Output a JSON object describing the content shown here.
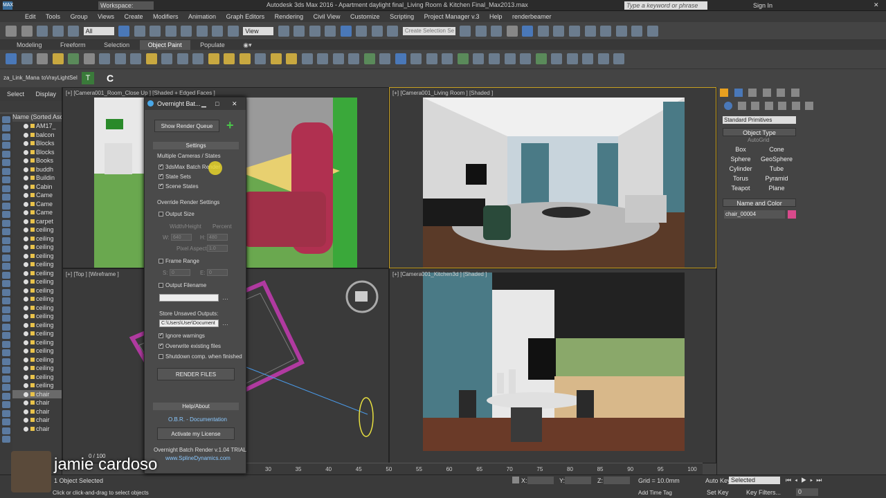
{
  "titlebar": {
    "workspace": "Workspace: Default",
    "title": "Autodesk 3ds Max 2016 - Apartment daylight final_Living Room & Kitchen Final_Max2013.max",
    "search_placeholder": "Type a keyword or phrase",
    "signin": "Sign In"
  },
  "menu": [
    "Edit",
    "Tools",
    "Group",
    "Views",
    "Create",
    "Modifiers",
    "Animation",
    "Graph Editors",
    "Rendering",
    "Civil View",
    "Customize",
    "Scripting",
    "Project Manager v.3",
    "Help",
    "renderbeamer"
  ],
  "toolbar": {
    "filter_value": "All",
    "view_value": "View",
    "selection_set_placeholder": "Create Selection Se"
  },
  "ribbon_tabs": [
    {
      "label": "Modeling",
      "active": false
    },
    {
      "label": "Freeform",
      "active": false
    },
    {
      "label": "Selection",
      "active": false
    },
    {
      "label": "Object Paint",
      "active": true
    },
    {
      "label": "Populate",
      "active": false
    }
  ],
  "tb3": {
    "btn1": "za_Link_Mana",
    "btn2": "toVrayLightSel"
  },
  "scene_explorer": {
    "tabs": [
      "Select",
      "Display"
    ],
    "column": "Name (Sorted Ascen",
    "items": [
      "AM17_",
      "balcon",
      "Blocks",
      "Blocks",
      "Books",
      "buddh",
      "Buildin",
      "Cabin",
      "Came",
      "Came",
      "Came",
      "carpet",
      "ceiling",
      "ceiling",
      "ceiling",
      "ceiling",
      "ceiling",
      "ceiling",
      "ceiling",
      "ceiling",
      "ceiling",
      "ceiling",
      "ceiling",
      "ceiling",
      "ceiling",
      "ceiling",
      "ceiling",
      "ceiling",
      "ceiling",
      "ceiling",
      "ceiling",
      "chair",
      "chair",
      "chair",
      "chair",
      "chair"
    ],
    "selected_index": 31
  },
  "viewports": [
    {
      "label": "[+] [Camera001_Room_Close Up ] [Shaded + Edged Faces ]"
    },
    {
      "label": "[+] [Camera001_Living Room ] [Shaded ]"
    },
    {
      "label": "[+] [Top ] [Wireframe ]"
    },
    {
      "label": "[+] [Camera001_Kitchen3d ] [Shaded ]"
    }
  ],
  "dialog": {
    "title": "Overnight Bat...",
    "show_queue": "Show Render Queue",
    "settings": "Settings",
    "multiple_cams": "Multiple Cameras / States",
    "opt_batch": "3dsMax Batch Render",
    "opt_state_sets": "State Sets",
    "opt_scene_states": "Scene States",
    "override": "Override Render Settings",
    "output_size": "Output Size",
    "width_height": "Width/Height",
    "percent": "Percent",
    "w_label": "W:",
    "w_value": "640",
    "h_label": "H:",
    "h_value": "480",
    "pixel_aspect": "Pixel Aspect",
    "pixel_aspect_value": "1.0",
    "frame_range": "Frame Range",
    "s_label": "S:",
    "s_value": "0",
    "e_label": "E:",
    "e_value": "0",
    "output_filename": "Output Filename",
    "store_unsaved": "Store Unsaved Outputs:",
    "store_path": "C:\\Users\\User\\Document",
    "ignore_warnings": "Ignore warnings",
    "overwrite": "Overwrite existing files",
    "shutdown": "Shutdown comp. when finished",
    "render_files": "RENDER FILES",
    "help_about": "Help/About",
    "documentation": "O.B.R. - Documentation",
    "activate": "Activate my License",
    "version": "Overnight Batch Render v.1.04 TRIAL",
    "website": "www.SplineDynamics.com"
  },
  "command_panel": {
    "category": "Standard Primitives",
    "object_type": "Object Type",
    "autogrid": "AutoGrid",
    "buttons": [
      "Box",
      "Cone",
      "Sphere",
      "GeoSphere",
      "Cylinder",
      "Tube",
      "Torus",
      "Pyramid",
      "Teapot",
      "Plane"
    ],
    "name_color": "Name and Color",
    "name_value": "chair_00004",
    "color_swatch": "#d94a8c"
  },
  "timeline": {
    "frame": "0 / 100",
    "ticks": [
      "30",
      "35",
      "40",
      "45",
      "50",
      "55",
      "60",
      "65",
      "70",
      "75",
      "80",
      "85",
      "90",
      "95",
      "100"
    ]
  },
  "status": {
    "objects_selected": "1 Object Selected",
    "prompt": "Click or click-and-drag to select objects",
    "x_label": "X:",
    "y_label": "Y:",
    "z_label": "Z:",
    "grid": "Grid = 10.0mm",
    "add_time_tag": "Add Time Tag",
    "auto_key": "Auto Key",
    "selected": "Selected",
    "set_key": "Set Key",
    "key_filters": "Key Filters...",
    "frame_value": "0"
  },
  "watermark": "jamie cardoso"
}
